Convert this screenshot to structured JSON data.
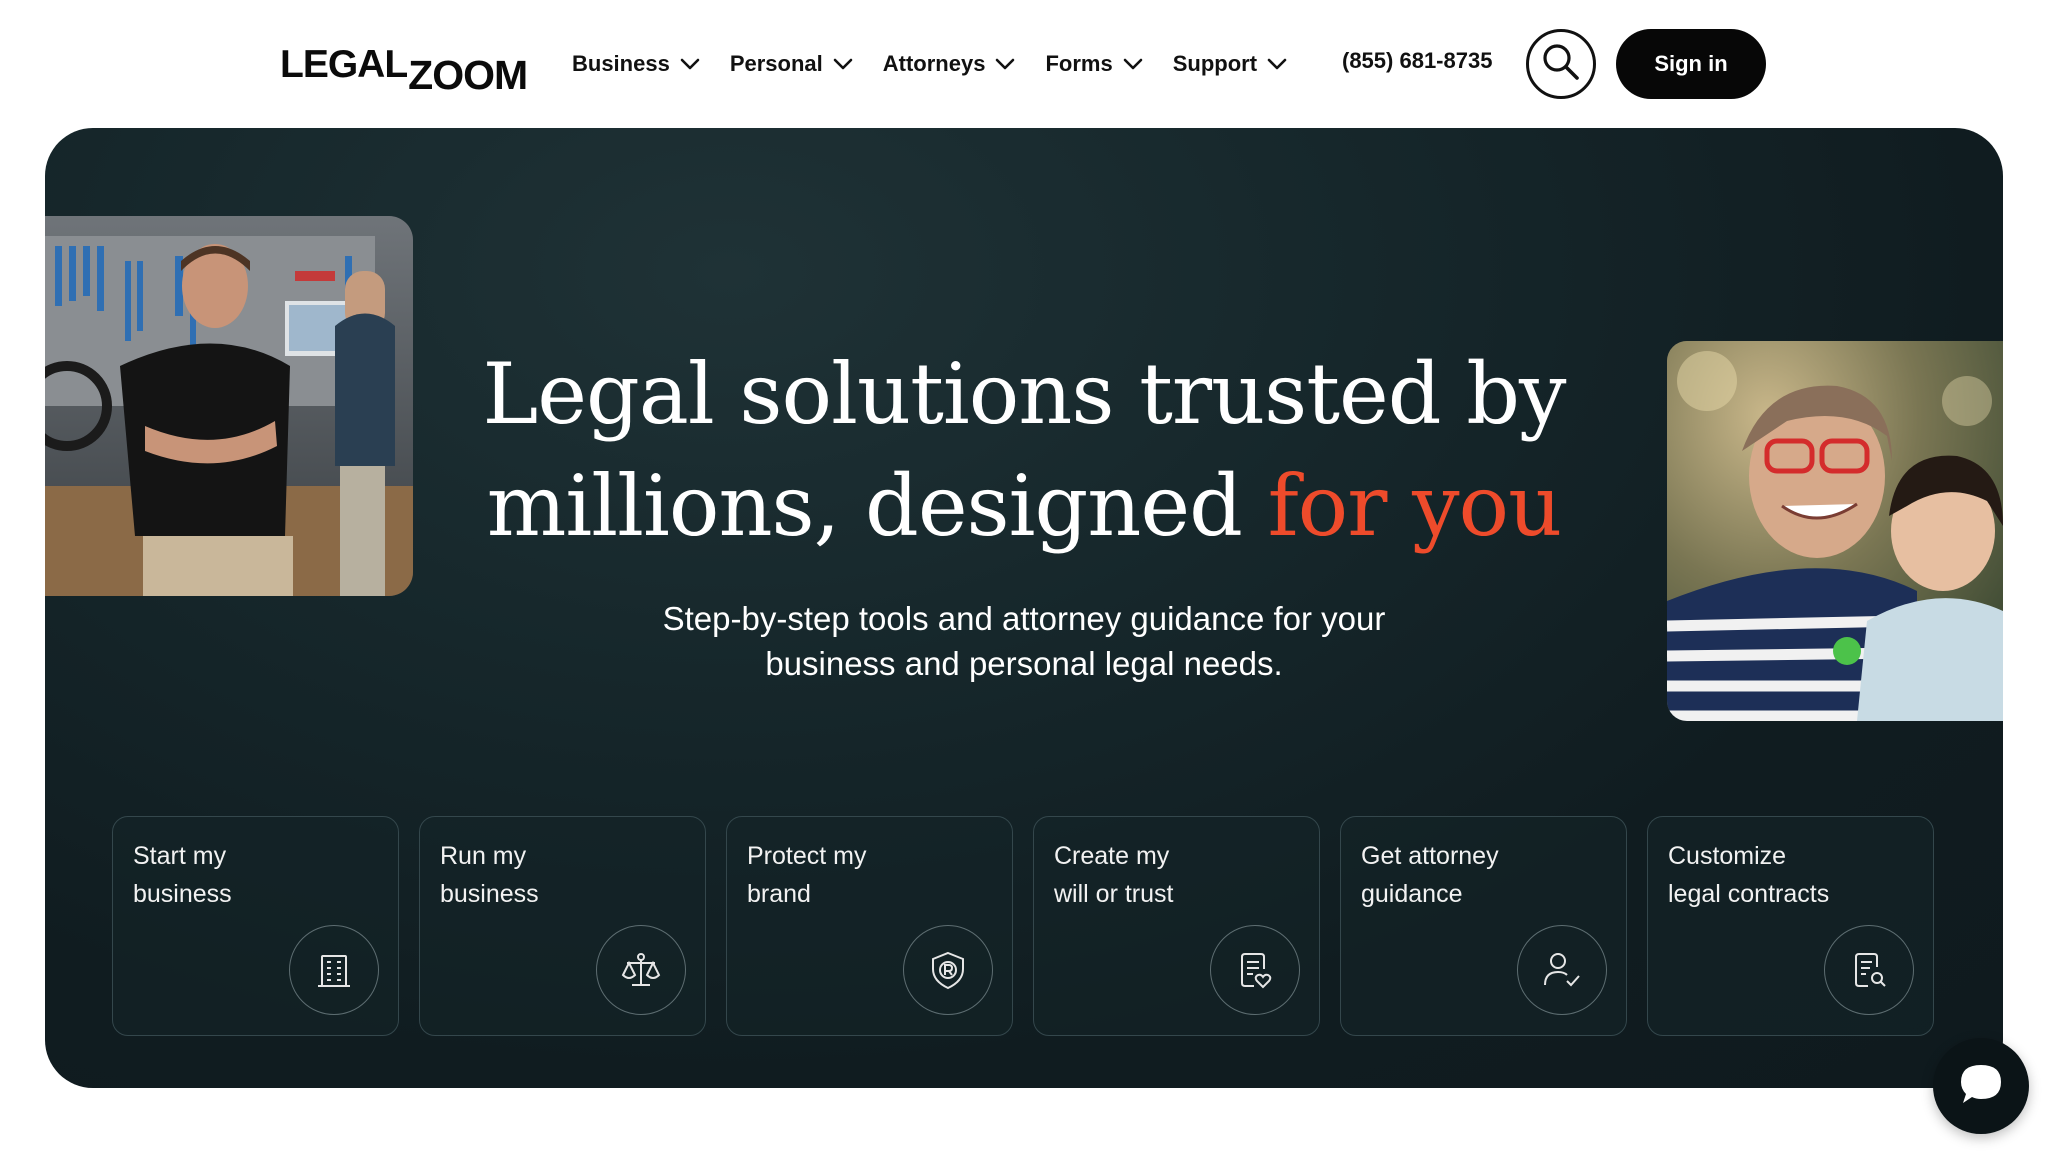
{
  "header": {
    "logo_part1": "LEGAL",
    "logo_part2": "ZOOM",
    "nav": [
      {
        "label": "Business"
      },
      {
        "label": "Personal"
      },
      {
        "label": "Attorneys"
      },
      {
        "label": "Forms"
      },
      {
        "label": "Support"
      }
    ],
    "phone": "(855) 681-8735",
    "search_icon": "search-icon",
    "signin_label": "Sign in"
  },
  "hero": {
    "headline_line1": "Legal solutions trusted by",
    "headline_line2_main": "millions, designed",
    "headline_line2_accent": "for you",
    "subtitle": "Step-by-step tools and attorney guidance for your business and personal legal needs.",
    "accent_color": "#ee4b2b",
    "background_color": "#13252a"
  },
  "cards": [
    {
      "label_line1": "Start my",
      "label_line2": "business",
      "icon": "building-icon"
    },
    {
      "label_line1": "Run my",
      "label_line2": "business",
      "icon": "scales-icon"
    },
    {
      "label_line1": "Protect my",
      "label_line2": "brand",
      "icon": "trademark-shield-icon"
    },
    {
      "label_line1": "Create my",
      "label_line2": "will or trust",
      "icon": "document-heart-icon"
    },
    {
      "label_line1": "Get attorney",
      "label_line2": "guidance",
      "icon": "person-check-icon"
    },
    {
      "label_line1": "Customize",
      "label_line2": "legal contracts",
      "icon": "document-search-icon"
    }
  ],
  "chat": {
    "icon": "chat-bubble-icon"
  }
}
